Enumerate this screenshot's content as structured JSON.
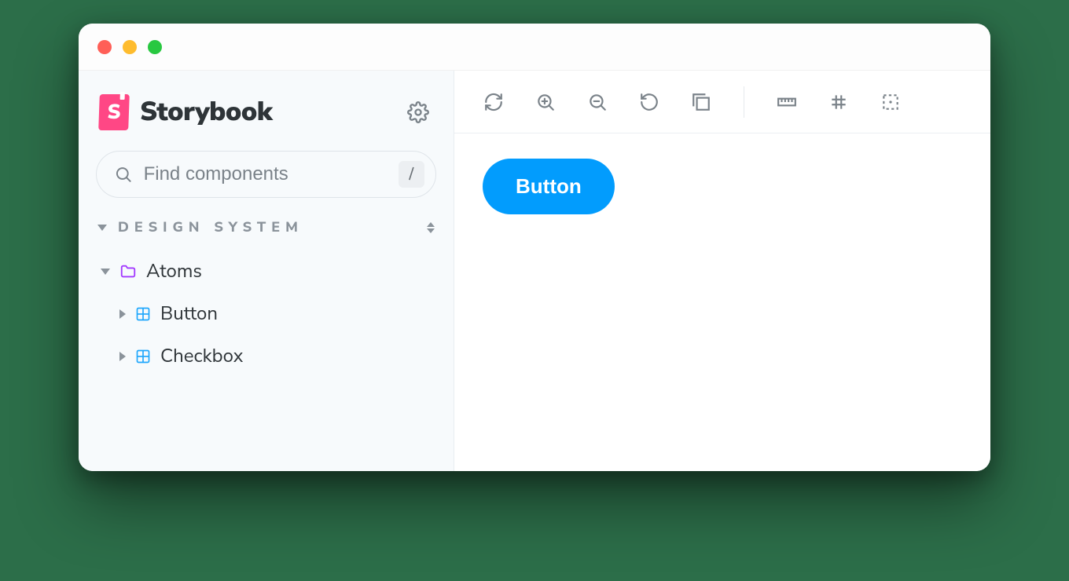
{
  "brand": {
    "name": "Storybook",
    "mark_letter": "S"
  },
  "search": {
    "placeholder": "Find components",
    "shortcut": "/"
  },
  "section": {
    "title": "DESIGN SYSTEM"
  },
  "tree": {
    "group": {
      "label": "Atoms"
    },
    "items": [
      {
        "label": "Button"
      },
      {
        "label": "Checkbox"
      }
    ]
  },
  "canvas": {
    "button_label": "Button"
  },
  "colors": {
    "accent": "#029cfd",
    "brand": "#ff4785"
  }
}
